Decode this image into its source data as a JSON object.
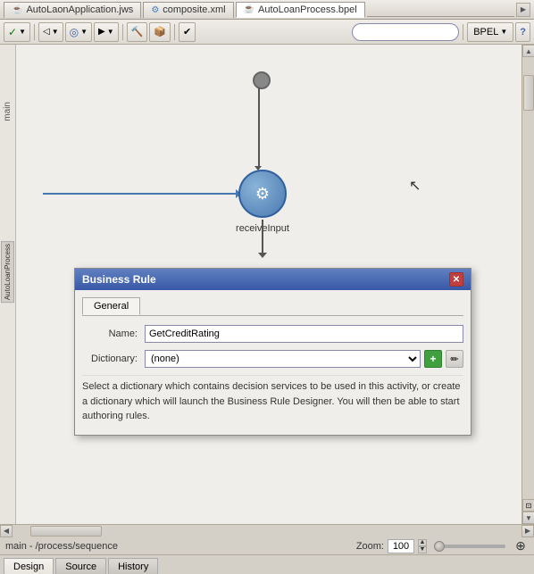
{
  "tabs": [
    {
      "label": "AutoLaonApplication.jws",
      "icon": "jws",
      "active": false
    },
    {
      "label": "composite.xml",
      "icon": "xml",
      "active": false
    },
    {
      "label": "AutoLoanProcess.bpel",
      "icon": "bpel",
      "active": true
    }
  ],
  "toolbar": {
    "search_placeholder": "",
    "bpel_label": "BPEL",
    "help_label": "?"
  },
  "canvas": {
    "receive_node_label": "receiveInput",
    "left_label": "main",
    "side_label": "AutoLoanProcess"
  },
  "dialog": {
    "title": "Business Rule",
    "tabs": [
      {
        "label": "General",
        "active": true
      }
    ],
    "name_label": "Name:",
    "name_value": "GetCreditRating",
    "dictionary_label": "Dictionary:",
    "dictionary_value": "(none)",
    "description": "Select a dictionary which contains decision services to be used in this activity, or create a dictionary which will launch the Business Rule Designer. You will then be able to start authoring rules.",
    "close_btn": "✕",
    "add_btn": "+",
    "edit_btn": "✏"
  },
  "status": {
    "path": "main - /process/sequence",
    "zoom_label": "Zoom:",
    "zoom_value": "100"
  },
  "bottom_tabs": [
    {
      "label": "Design",
      "active": true
    },
    {
      "label": "Source",
      "active": false
    },
    {
      "label": "History",
      "active": false
    }
  ]
}
